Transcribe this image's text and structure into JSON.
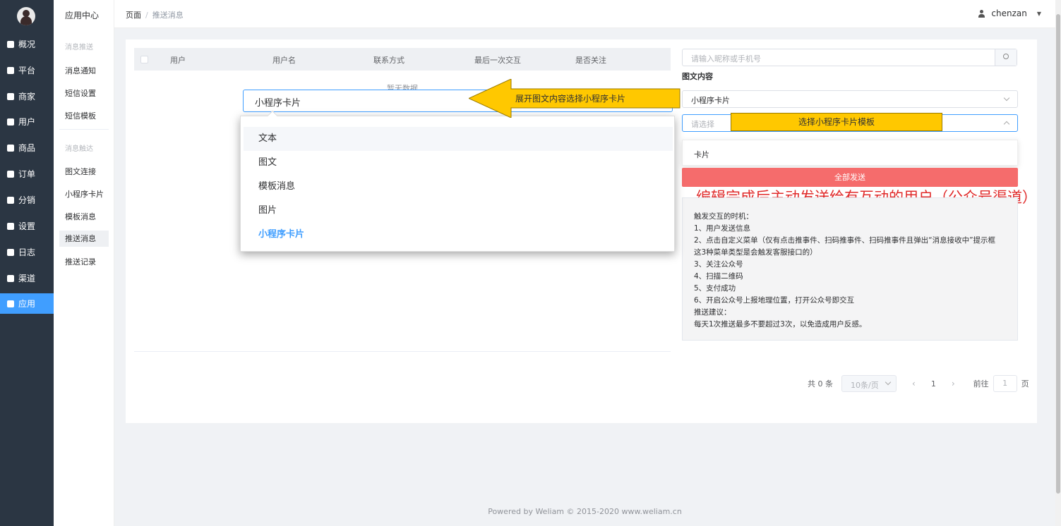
{
  "nav": {
    "items": [
      {
        "label": "概况",
        "icon": "monitor-icon"
      },
      {
        "label": "平台",
        "icon": "platform-icon"
      },
      {
        "label": "商家",
        "icon": "store-icon"
      },
      {
        "label": "用户",
        "icon": "user-icon"
      },
      {
        "label": "商品",
        "icon": "goods-icon"
      },
      {
        "label": "订单",
        "icon": "order-icon"
      },
      {
        "label": "分销",
        "icon": "distribution-icon"
      },
      {
        "label": "设置",
        "icon": "gear-icon"
      },
      {
        "label": "日志",
        "icon": "log-icon"
      },
      {
        "label": "渠道",
        "icon": "channel-icon"
      },
      {
        "label": "应用",
        "icon": "grid-icon"
      }
    ],
    "active_color": "#409eff"
  },
  "submenu": {
    "title": "应用中心",
    "group1": "消息推送",
    "group1_items": [
      "消息通知",
      "短信设置",
      "短信模板"
    ],
    "group2": "消息触达",
    "group2_items": [
      "图文连接",
      "小程序卡片",
      "模板消息",
      "推送消息",
      "推送记录"
    ]
  },
  "topbar": {
    "crumb1": "页面",
    "crumb_sep": "/",
    "crumb2": "推送消息",
    "username": "chenzan",
    "caret": "▼"
  },
  "table": {
    "headers": [
      "用户",
      "用户名",
      "联系方式",
      "最后一次交互",
      "是否关注"
    ],
    "empty": "暂无数据"
  },
  "right": {
    "search_placeholder": "请输入昵称或手机号",
    "content_label": "图文内容",
    "select1_value": "小程序卡片",
    "select2_placeholder": "请选择",
    "select2_option": "卡片",
    "send_button": "全部发送",
    "caption": "编辑完成后主动发送给有互动的用户（公众号渠道）",
    "tips": [
      "触发交互的时机：",
      "1、用户发送信息",
      "2、点击自定义菜单（仅有点击推事件、扫码推事件、扫码推事件且弹出“消息接收中”提示框",
      "这3种菜单类型是会触发客服接口的）",
      "3、关注公众号",
      "4、扫描二维码",
      "5、支付成功",
      "6、开启公众号上报地理位置，打开公众号即交互",
      "推送建议：",
      "每天1次推送最多不要超过3次，以免造成用户反感。"
    ],
    "send_color": "#f56c6c"
  },
  "pager": {
    "total": "共 0 条",
    "page_size": "10条/页",
    "prev": "‹",
    "page": "1",
    "next": "›",
    "goto": "前往",
    "goto_value": "1",
    "page_suffix": "页"
  },
  "overlay": {
    "select_value": "小程序卡片",
    "options": [
      "文本",
      "图文",
      "模板消息",
      "图片",
      "小程序卡片"
    ],
    "selected_option": "小程序卡片",
    "callout1": "展开图文内容选择小程序卡片",
    "callout2": "选择小程序卡片模板",
    "callout_color": "#ffc800"
  },
  "footer": "Powered by Weliam © 2015-2020 www.weliam.cn"
}
